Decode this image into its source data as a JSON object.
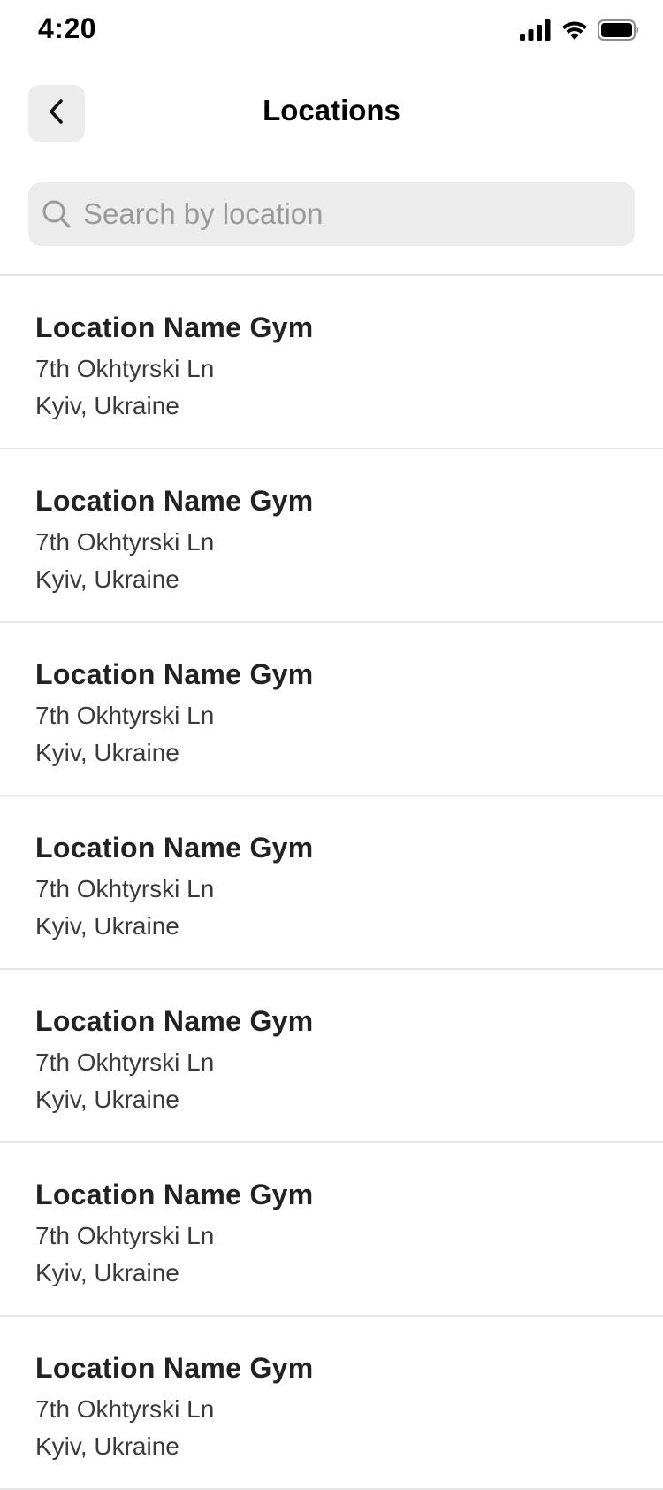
{
  "status_bar": {
    "time": "4:20",
    "icons": [
      "cellular-signal-icon",
      "wifi-icon",
      "battery-icon"
    ]
  },
  "nav": {
    "back_icon": "chevron-left-icon",
    "title": "Locations"
  },
  "search": {
    "icon": "search-icon",
    "placeholder": "Search by location",
    "value": ""
  },
  "locations": [
    {
      "name": "Location Name Gym",
      "street": "7th Okhtyrski Ln",
      "city": "Kyiv, Ukraine"
    },
    {
      "name": "Location Name Gym",
      "street": "7th Okhtyrski Ln",
      "city": "Kyiv, Ukraine"
    },
    {
      "name": "Location Name Gym",
      "street": "7th Okhtyrski Ln",
      "city": "Kyiv, Ukraine"
    },
    {
      "name": "Location Name Gym",
      "street": "7th Okhtyrski Ln",
      "city": "Kyiv, Ukraine"
    },
    {
      "name": "Location Name Gym",
      "street": "7th Okhtyrski Ln",
      "city": "Kyiv, Ukraine"
    },
    {
      "name": "Location Name Gym",
      "street": "7th Okhtyrski Ln",
      "city": "Kyiv, Ukraine"
    },
    {
      "name": "Location Name Gym",
      "street": "7th Okhtyrski Ln",
      "city": "Kyiv, Ukraine"
    }
  ],
  "colors": {
    "background": "#ffffff",
    "control_fill": "#ececec",
    "divider": "#e6e6e6",
    "primary_text": "#222222",
    "secondary_text": "#3a3a3a",
    "placeholder_text": "#9a9a9a"
  }
}
